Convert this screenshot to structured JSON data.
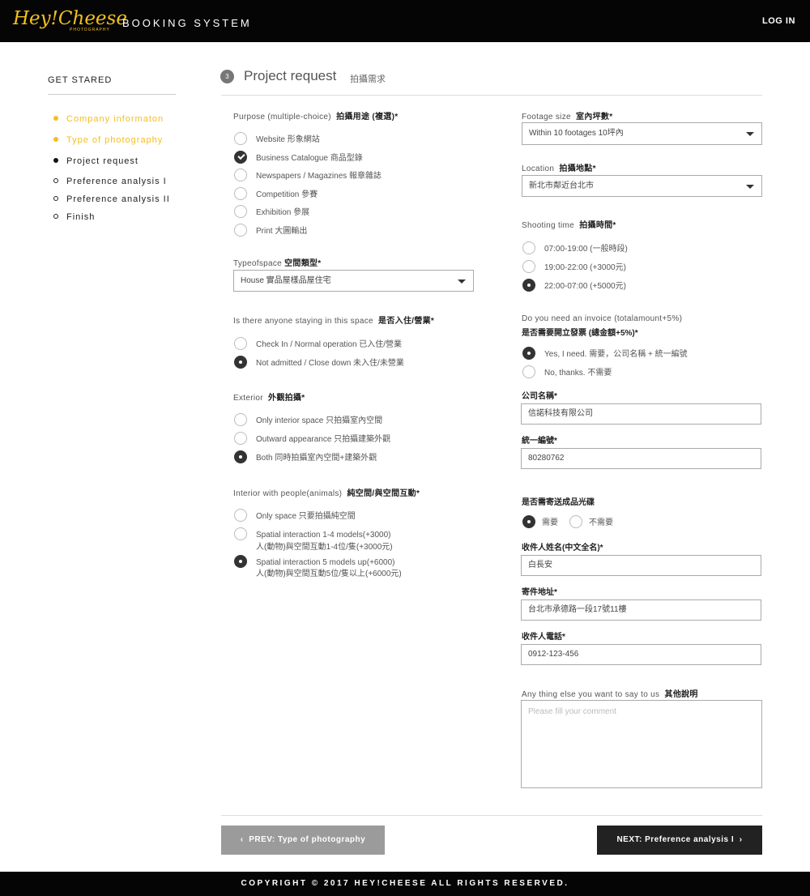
{
  "header": {
    "logo": "Hey!Cheese",
    "logo_sub": "PHOTOGRAPHY",
    "title": "BOOKING SYSTEM",
    "login": "LOG IN"
  },
  "sidebar": {
    "title": "GET STARED",
    "steps": [
      {
        "label": "Company informaton",
        "state": "done"
      },
      {
        "label": "Type of photography",
        "state": "done"
      },
      {
        "label": "Project request",
        "state": "active"
      },
      {
        "label": "Preference analysis I",
        "state": "todo"
      },
      {
        "label": "Preference analysis II",
        "state": "todo"
      },
      {
        "label": "Finish",
        "state": "todo"
      }
    ]
  },
  "section": {
    "number": "3",
    "title": "Project request",
    "subtitle": "拍攝需求"
  },
  "purpose": {
    "label": "Purpose (multiple-choice)",
    "label_zh": "拍攝用途 (複選)*",
    "options": [
      {
        "text": "Website 形象網站",
        "selected": false
      },
      {
        "text": "Business Catalogue 商品型錄",
        "selected": true
      },
      {
        "text": "Newspapers / Magazines 報章雜誌",
        "selected": false
      },
      {
        "text": "Competition 參賽",
        "selected": false
      },
      {
        "text": "Exhibition 參展",
        "selected": false
      },
      {
        "text": "Print 大圖輸出",
        "selected": false
      }
    ]
  },
  "space_type": {
    "label": "Typeofspace",
    "label_zh": "空間類型*",
    "value": "House 實品屋樣品屋住宅"
  },
  "staying": {
    "label": "Is there anyone staying in this space",
    "label_zh": "是否入住/營業*",
    "options": [
      {
        "text": "Check In / Normal operation 已入住/營業",
        "selected": false
      },
      {
        "text": "Not admitted / Close down 未入住/未營業",
        "selected": true
      }
    ]
  },
  "exterior": {
    "label": "Exterior",
    "label_zh": "外觀拍攝*",
    "options": [
      {
        "text": "Only interior space 只拍攝室內空間",
        "selected": false
      },
      {
        "text": "Outward appearance 只拍攝建築外觀",
        "selected": false
      },
      {
        "text": "Both 同時拍攝室內空間+建築外觀",
        "selected": true
      }
    ]
  },
  "interior": {
    "label": "Interior with people(animals)",
    "label_zh": "純空間/與空間互動*",
    "options": [
      {
        "text": "Only space 只要拍攝純空間",
        "text2": "",
        "selected": false
      },
      {
        "text": "Spatial interaction 1-4 models(+3000)",
        "text2": "人(動物)與空間互動1-4位/隻(+3000元)",
        "selected": false
      },
      {
        "text": "Spatial interaction 5 models up(+6000)",
        "text2": "人(動物)與空間互動5位/隻以上(+6000元)",
        "selected": true
      }
    ]
  },
  "footage": {
    "label": "Footage size",
    "label_zh": "室內坪數*",
    "value": "Within 10 footages 10坪內"
  },
  "location": {
    "label": "Location",
    "label_zh": "拍攝地點*",
    "value": "新北市鄰近台北市"
  },
  "shooting_time": {
    "label": "Shooting time",
    "label_zh": "拍攝時間*",
    "options": [
      {
        "text": "07:00-19:00 (一般時段)",
        "selected": false
      },
      {
        "text": "19:00-22:00 (+3000元)",
        "selected": false
      },
      {
        "text": "22:00-07:00 (+5000元)",
        "selected": true
      }
    ]
  },
  "invoice": {
    "label": "Do you need an invoice (totalamount+5%)",
    "label_zh": "是否需要開立發票 (總金額+5%)*",
    "options": [
      {
        "text": "Yes, I need.  需要，公司名稱 + 統一編號",
        "selected": true
      },
      {
        "text": "No, thanks. 不需要",
        "selected": false
      }
    ]
  },
  "company_name": {
    "label": "公司名稱*",
    "value": "信諾科技有限公司"
  },
  "tax_id": {
    "label": "統一編號*",
    "value": "80280762"
  },
  "disc": {
    "label": "是否需寄送成品光碟",
    "options": [
      {
        "text": "需要",
        "selected": true
      },
      {
        "text": "不需要",
        "selected": false
      }
    ]
  },
  "recipient_name": {
    "label": "收件人姓名(中文全名)*",
    "value": "白長安"
  },
  "address": {
    "label": "寄件地址*",
    "value": "台北市承德路一段17號11樓"
  },
  "phone": {
    "label": "收件人電話*",
    "value": "0912-123-456"
  },
  "comment": {
    "label": "Any thing else you want to say to us",
    "label_zh": "其他說明",
    "placeholder": "Please fill your comment"
  },
  "nav": {
    "prev": "PREV: Type of photography",
    "next": "NEXT: Preference analysis I"
  },
  "footer": {
    "copyright": "COPYRIGHT © 2017 HEY!CHEESE ALL RIGHTS RESERVED."
  }
}
